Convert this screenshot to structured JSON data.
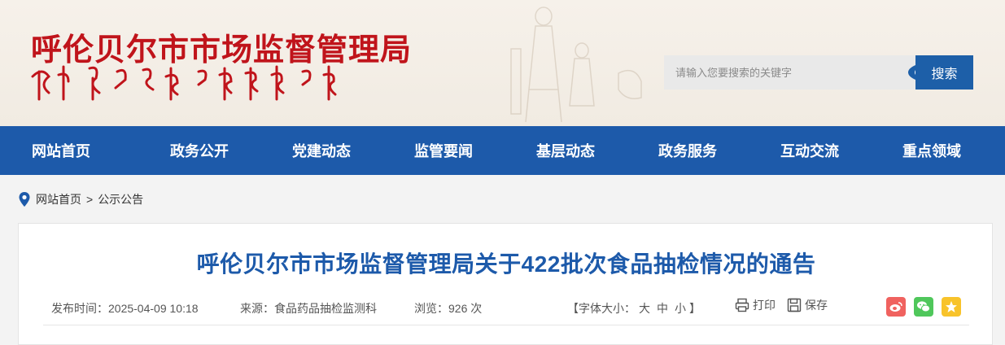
{
  "header": {
    "logo_title": "呼伦贝尔市市场监督管理局",
    "search_placeholder": "请输入您要搜索的关键字",
    "search_button": "搜索"
  },
  "nav": {
    "items": [
      "网站首页",
      "政务公开",
      "党建动态",
      "监管要闻",
      "基层动态",
      "政务服务",
      "互动交流",
      "重点领域"
    ]
  },
  "breadcrumb": {
    "home": "网站首页",
    "separator": ">",
    "current": "公示公告"
  },
  "article": {
    "title": "呼伦贝尔市市场监督管理局关于422批次食品抽检情况的通告",
    "publish_time": "发布时间：2025-04-09 10:18",
    "source": "来源：食品药品抽检监测科",
    "views": "浏览：926 次",
    "font_size_prefix": "【字体大小：",
    "font_size_large": "大",
    "font_size_medium": "中",
    "font_size_small": "小",
    "font_size_suffix": "】",
    "print_label": "打印",
    "save_label": "保存"
  },
  "colors": {
    "brand_blue": "#1d5aaa",
    "logo_red": "#c0141b",
    "weibo": "#f0625f",
    "wechat": "#4fc75b",
    "qzone": "#f8c32b"
  },
  "icons": {
    "location": "location-pin-icon",
    "print": "printer-icon",
    "save": "save-icon",
    "weibo": "weibo-icon",
    "wechat": "wechat-icon",
    "qzone": "qzone-star-icon"
  }
}
